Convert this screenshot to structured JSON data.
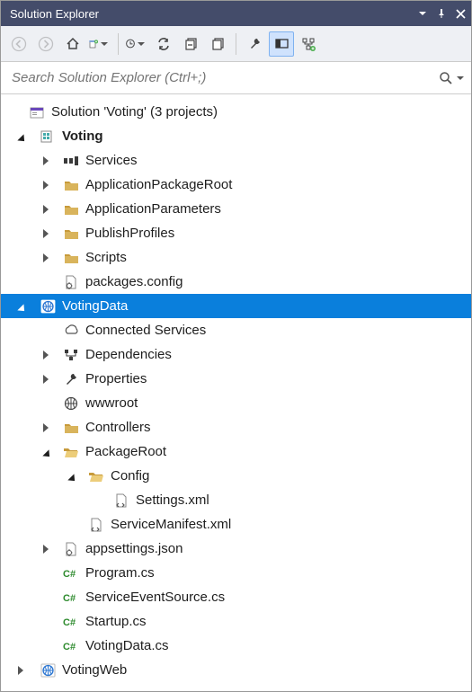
{
  "title": "Solution Explorer",
  "search_placeholder": "Search Solution Explorer (Ctrl+;)",
  "tree": {
    "solution": "Solution 'Voting' (3 projects)",
    "voting": "Voting",
    "voting_services": "Services",
    "voting_apr": "ApplicationPackageRoot",
    "voting_ap": "ApplicationParameters",
    "voting_pp": "PublishProfiles",
    "voting_scripts": "Scripts",
    "voting_pkg": "packages.config",
    "votingdata": "VotingData",
    "vd_connected": "Connected Services",
    "vd_deps": "Dependencies",
    "vd_props": "Properties",
    "vd_www": "wwwroot",
    "vd_controllers": "Controllers",
    "vd_pkgroot": "PackageRoot",
    "vd_config": "Config",
    "vd_settingsxml": "Settings.xml",
    "vd_smanifest": "ServiceManifest.xml",
    "vd_appsettings": "appsettings.json",
    "vd_program": "Program.cs",
    "vd_ses": "ServiceEventSource.cs",
    "vd_startup": "Startup.cs",
    "vd_votingdatacs": "VotingData.cs",
    "votingweb": "VotingWeb"
  }
}
